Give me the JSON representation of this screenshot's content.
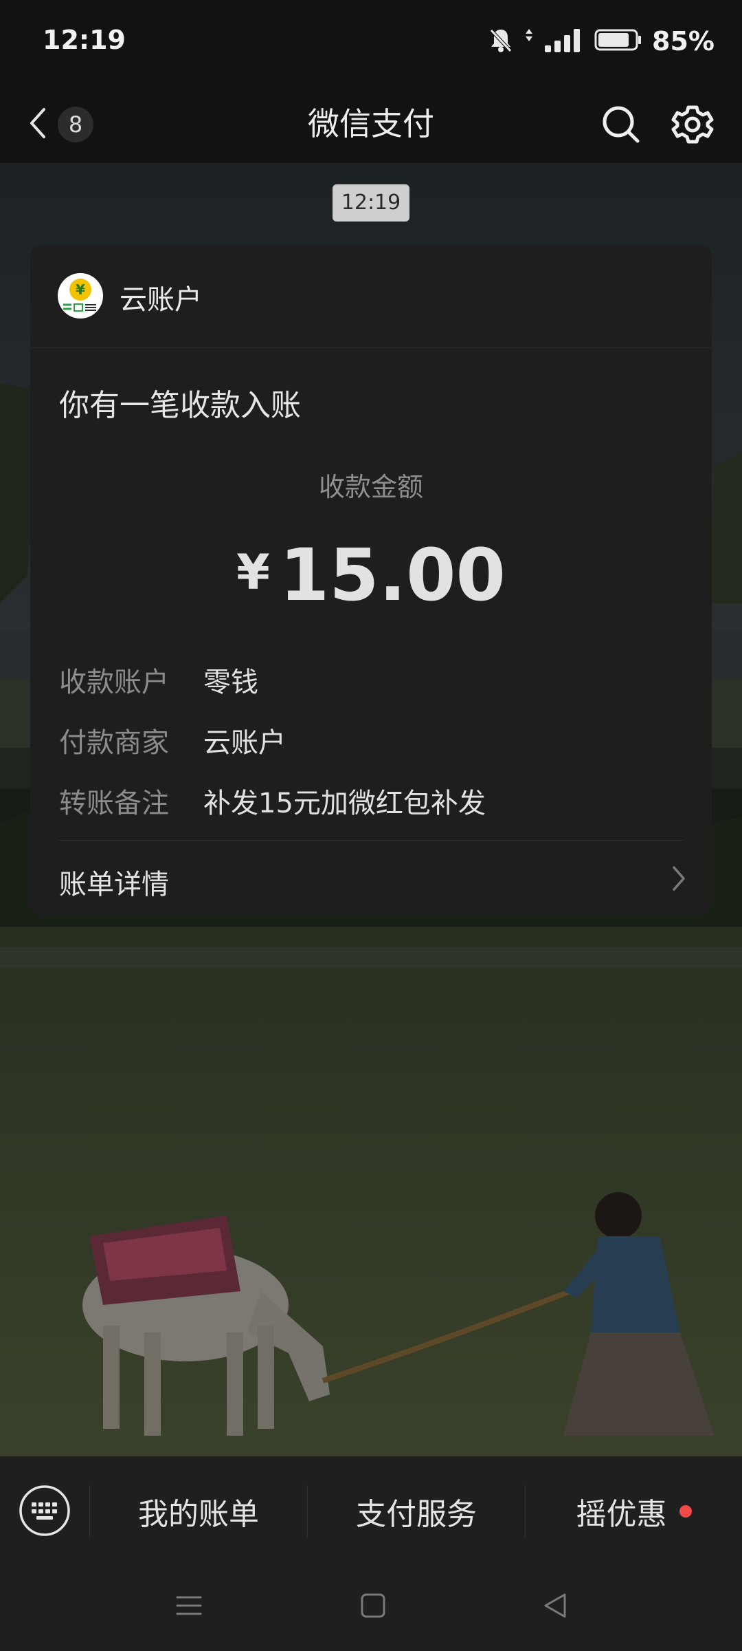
{
  "status_bar": {
    "time": "12:19",
    "battery_percent": "85%",
    "battery_level": 0.85,
    "icons": [
      "bell-muted-icon",
      "data-arrows-icon",
      "signal-icon",
      "battery-icon"
    ]
  },
  "header": {
    "back_icon": "chevron-left-icon",
    "unread_count": "8",
    "title": "微信支付",
    "search_icon": "search-icon",
    "settings_icon": "gear-icon"
  },
  "message": {
    "time": "12:19",
    "merchant_name": "云账户",
    "merchant_logo_icon": "yuan-coin-logo",
    "title": "你有一笔收款入账",
    "amount_label": "收款金额",
    "currency_symbol": "¥",
    "amount": "15.00",
    "rows": [
      {
        "key": "收款账户",
        "value": "零钱"
      },
      {
        "key": "付款商家",
        "value": "云账户"
      },
      {
        "key": "转账备注",
        "value": "补发15元加微红包补发"
      }
    ],
    "detail_label": "账单详情",
    "detail_icon": "chevron-right-icon"
  },
  "bottom_menu": {
    "keyboard_icon": "keyboard-icon",
    "items": [
      {
        "label": "我的账单"
      },
      {
        "label": "支付服务"
      },
      {
        "label": "摇优惠",
        "has_red_dot": true
      }
    ]
  },
  "nav_bar": {
    "icons": [
      "menu-icon",
      "home-square-icon",
      "back-triangle-icon"
    ]
  },
  "colors": {
    "background": "#111111",
    "card": "#1e1e1e",
    "red_dot": "#f24a4a",
    "time_bubble": "#cfcfcf"
  }
}
